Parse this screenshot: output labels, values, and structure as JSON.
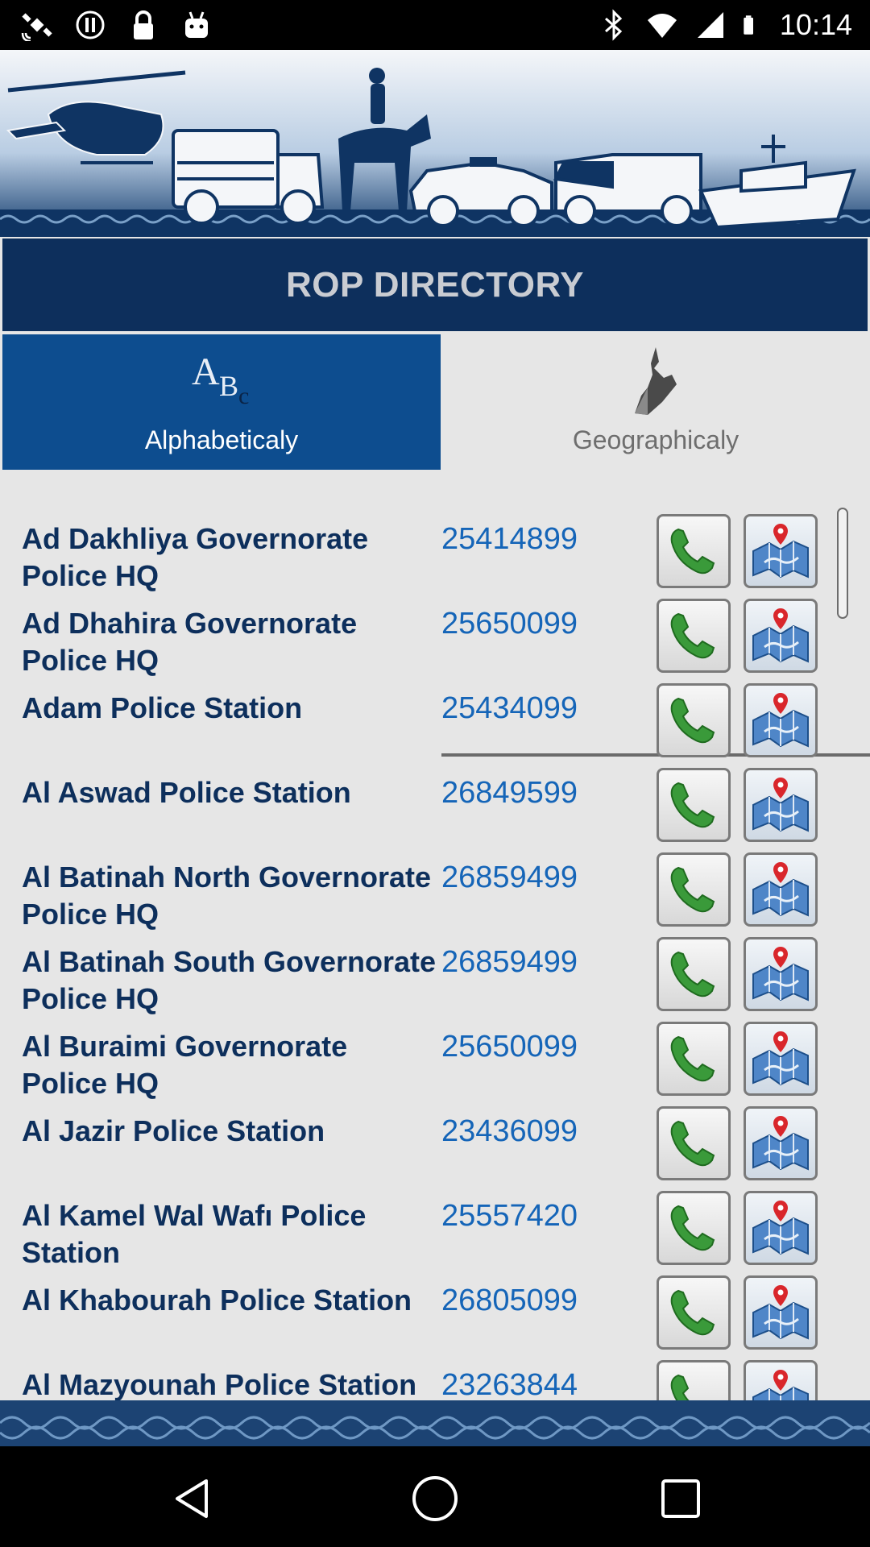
{
  "status_bar": {
    "time": "10:14",
    "left_icons": [
      "satellite-icon",
      "alert-circle-icon",
      "lock-icon",
      "android-icon"
    ],
    "right_icons": [
      "bluetooth-icon",
      "wifi-icon",
      "signal-icon",
      "battery-icon"
    ]
  },
  "header": {
    "title": "ROP DIRECTORY"
  },
  "tabs": [
    {
      "label": "Alphabeticaly",
      "icon": "abc-icon",
      "active": true
    },
    {
      "label": "Geographicaly",
      "icon": "oman-map-icon",
      "active": false
    }
  ],
  "directory": [
    {
      "name": "Ad Dakhliya Governorate Police HQ",
      "phone": "25414899"
    },
    {
      "name": "Ad Dhahira Governorate Police HQ",
      "phone": "25650099"
    },
    {
      "name": "Adam Police Station",
      "phone": "25434099"
    },
    {
      "name": "Al Aswad Police Station",
      "phone": "26849599"
    },
    {
      "name": "Al Batinah North Governorate Police HQ",
      "phone": "26859499"
    },
    {
      "name": "Al Batinah South Governorate Police HQ",
      "phone": "26859499"
    },
    {
      "name": "Al Buraimi Governorate Police HQ",
      "phone": "25650099"
    },
    {
      "name": "Al Jazir Police Station",
      "phone": "23436099"
    },
    {
      "name": "Al Kamel Wal Wafı Police Station",
      "phone": "25557420"
    },
    {
      "name": "Al Khabourah Police Station",
      "phone": "26805099"
    },
    {
      "name": "Al Mazyounah Police Station",
      "phone": "23263844"
    }
  ],
  "colors": {
    "navy": "#0d2f5c",
    "active_tab": "#0d4d8f",
    "phone_blue": "#1565b8",
    "call_green": "#3a9a3a",
    "background": "#e6e6e6"
  },
  "navbar": [
    "back-icon",
    "home-icon",
    "recents-icon"
  ]
}
